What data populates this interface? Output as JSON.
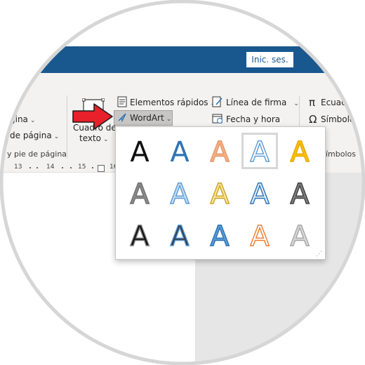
{
  "titlebar": {
    "signin_label": "Inic. ses."
  },
  "ribbon": {
    "left_items": [
      "gina",
      "de página"
    ],
    "left_group_label": "y pie de página",
    "textbox_label_line1": "Cuadro de",
    "textbox_label_line2": "texto",
    "quick_parts_label": "Elementos rápidos",
    "wordart_label": "WordArt",
    "signature_line_label": "Línea de firma",
    "date_time_label": "Fecha y hora",
    "equation_label": "Ecuac",
    "symbol_label": "Símbolo",
    "symbols_group_label": "ímbolos"
  },
  "ruler": {
    "numbers": [
      "13",
      "14",
      "15",
      "16"
    ]
  },
  "gallery": {
    "glyph": "A",
    "styles": [
      {
        "fill": "#111111",
        "stroke": "none",
        "style": "plain black"
      },
      {
        "fill": "#2e74b5",
        "stroke": "none",
        "style": "blue"
      },
      {
        "fill": "#f4b183",
        "stroke": "#e5986b",
        "style": "orange outline"
      },
      {
        "fill": "#ffffff",
        "stroke": "#5b9bd5",
        "style": "white blue outline",
        "selected": true
      },
      {
        "fill": "#ffc000",
        "stroke": "#e6a800",
        "style": "gold"
      },
      {
        "fill": "#8c8c8c",
        "stroke": "#6f6f6f",
        "style": "gray"
      },
      {
        "fill": "#c5def0",
        "stroke": "#5b9bd5",
        "style": "light blue reflection"
      },
      {
        "fill": "#ffe699",
        "stroke": "#c9a227",
        "style": "yellow outline"
      },
      {
        "fill": "#deebf7",
        "stroke": "#2e74b5",
        "style": "pale blue outline"
      },
      {
        "fill": "#7f7f7f",
        "stroke": "#404040",
        "style": "gray gradient"
      },
      {
        "fill": "#111111",
        "stroke": "#7f7f7f",
        "style": "black shadow"
      },
      {
        "fill": "#333f4f",
        "stroke": "#5b9bd5",
        "style": "dark blue glow"
      },
      {
        "fill": "#5b9bd5",
        "stroke": "#2e74b5",
        "style": "blue bevel"
      },
      {
        "fill": "#ffffff",
        "stroke": "#ed7d31",
        "style": "white orange outline"
      },
      {
        "fill": "#d9d9d9",
        "stroke": "#a6a6a6",
        "style": "silver"
      }
    ]
  },
  "colors": {
    "accent": "#19578f",
    "arrow": "#e8202a"
  }
}
